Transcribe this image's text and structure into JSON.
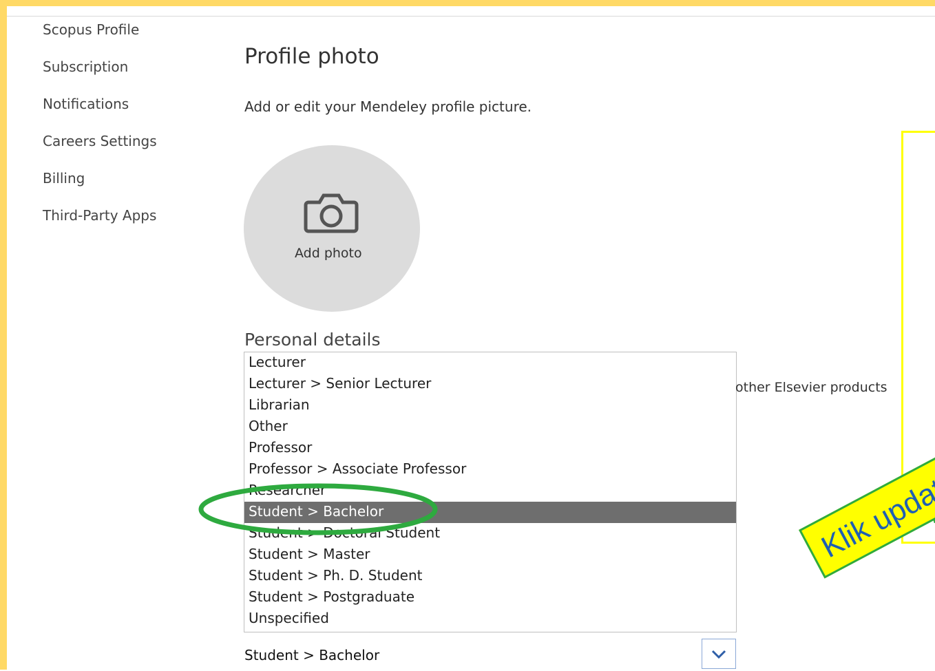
{
  "sidebar": {
    "items": [
      {
        "label": "Scopus Profile"
      },
      {
        "label": "Subscription"
      },
      {
        "label": "Notifications"
      },
      {
        "label": "Careers Settings"
      },
      {
        "label": "Billing"
      },
      {
        "label": "Third-Party Apps"
      }
    ]
  },
  "profile_photo": {
    "title": "Profile photo",
    "description": "Add or edit your Mendeley profile picture.",
    "add_label": "Add photo",
    "icon": "camera-icon"
  },
  "personal_details": {
    "title": "Personal details",
    "partial_text": "other Elsevier products",
    "position_options": [
      "Lecturer",
      "Lecturer > Senior Lecturer",
      "Librarian",
      "Other",
      "Professor",
      "Professor > Associate Professor",
      "Researcher",
      "Student > Bachelor",
      "Student > Doctoral Student",
      "Student > Master",
      "Student > Ph. D. Student",
      "Student > Postgraduate",
      "Unspecified"
    ],
    "selected_value": "Student > Bachelor"
  },
  "annotation": {
    "label": "Klik update",
    "colors": {
      "highlight": "#ffff00",
      "border": "#2eaa3f",
      "text": "#1e5fb3"
    }
  }
}
